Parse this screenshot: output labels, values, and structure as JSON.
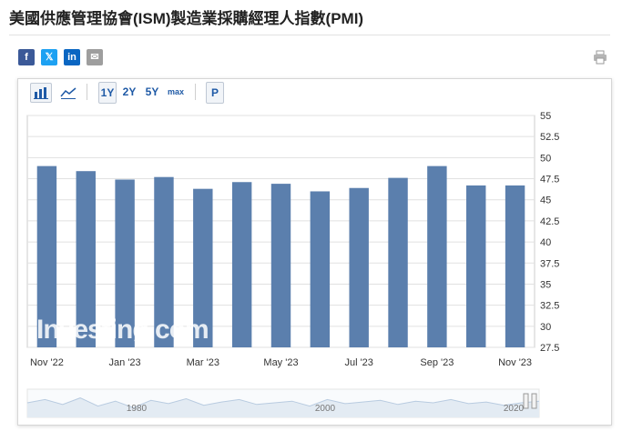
{
  "page": {
    "title": "美國供應管理協會(ISM)製造業採購經理人指數(PMI)"
  },
  "share": {
    "facebook": "f",
    "twitter": "𝕏",
    "linkedin": "in",
    "email": "✉",
    "print_icon": "printer-icon"
  },
  "toolbar": {
    "bar_icon": "bar-chart-icon",
    "line_icon": "line-chart-icon",
    "periods": [
      "1Y",
      "2Y",
      "5Y",
      "max"
    ],
    "selected_period": "1Y",
    "p_label": "P"
  },
  "colors": {
    "bar": "#5b7fad",
    "navigator_line": "#b8cbe0",
    "navigator_fill": "#e3ebf3",
    "grid": "#e1e1e1"
  },
  "chart_data": {
    "type": "bar",
    "categories": [
      "Nov '22",
      "Dec '22",
      "Jan '23",
      "Feb '23",
      "Mar '23",
      "Apr '23",
      "May '23",
      "Jun '23",
      "Jul '23",
      "Aug '23",
      "Sep '23",
      "Oct '23",
      "Nov '23"
    ],
    "values": [
      49.0,
      48.4,
      47.4,
      47.7,
      46.3,
      47.1,
      46.9,
      46.0,
      46.4,
      47.6,
      49.0,
      46.7,
      46.7
    ],
    "x_tick_labels": [
      "Nov '22",
      "Jan '23",
      "Mar '23",
      "May '23",
      "Jul '23",
      "Sep '23",
      "Nov '23"
    ],
    "y_ticks": [
      27.5,
      30,
      32.5,
      35,
      37.5,
      40,
      42.5,
      45,
      47.5,
      50,
      52.5,
      55
    ],
    "y_tick_labels": [
      "27.5",
      "30",
      "32.5",
      "35",
      "37.5",
      "40",
      "42.5",
      "45",
      "47.5",
      "50",
      "52.5",
      "55"
    ],
    "ylim": [
      27.5,
      55
    ],
    "grid": true,
    "y_axis_position": "right",
    "watermark": "Investing.com",
    "navigator_labels": [
      "1980",
      "2000",
      "2020"
    ]
  }
}
